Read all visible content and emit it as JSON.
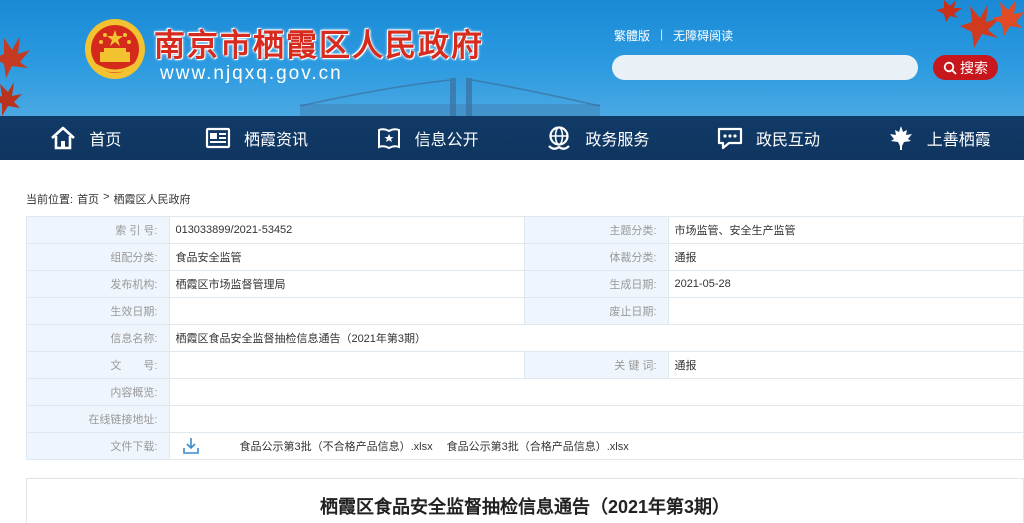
{
  "header": {
    "site_title": "南京市栖霞区人民政府",
    "site_url": "www.njqxq.gov.cn",
    "links": [
      "繁體版",
      "无障碍阅读"
    ],
    "search": {
      "placeholder": "",
      "button_label": "搜索"
    },
    "colors": {
      "header_blue": "#2b9ae0",
      "title_red": "#d62b1e",
      "nav_navy": "#113a66",
      "search_red": "#c8161d"
    }
  },
  "nav": {
    "items": [
      {
        "label": "首页",
        "icon": "home-icon"
      },
      {
        "label": "栖霞资讯",
        "icon": "news-icon"
      },
      {
        "label": "信息公开",
        "icon": "info-book-icon"
      },
      {
        "label": "政务服务",
        "icon": "service-globe-icon"
      },
      {
        "label": "政民互动",
        "icon": "chat-icon"
      },
      {
        "label": "上善栖霞",
        "icon": "maple-leaf-icon"
      }
    ]
  },
  "breadcrumb": {
    "prefix": "当前位置:",
    "items": [
      "首页",
      "栖霞区人民政府"
    ],
    "separator": ">"
  },
  "meta": {
    "index_label": "索 引 号:",
    "index_value": "013033899/2021-53452",
    "topic_label": "主题分类:",
    "topic_value": "市场监管、安全生产监管",
    "group_label": "组配分类:",
    "group_value": "食品安全监管",
    "genre_label": "体裁分类:",
    "genre_value": "通报",
    "publisher_label": "发布机构:",
    "publisher_value": "栖霞区市场监督管理局",
    "created_label": "生成日期:",
    "created_value": "2021-05-28",
    "effective_label": "生效日期:",
    "effective_value": "",
    "expire_label": "废止日期:",
    "expire_value": "",
    "name_label": "信息名称:",
    "name_value": "栖霞区食品安全监督抽检信息通告（2021年第3期）",
    "doc_label": "文　　号:",
    "doc_value": "",
    "keyword_label": "关 键 词:",
    "keyword_value": "通报",
    "summary_label": "内容概览:",
    "summary_value": "",
    "link_label": "在线链接地址:",
    "link_value": "",
    "download_label": "文件下载:",
    "downloads": [
      "食品公示第3批（不合格产品信息）.xlsx",
      "食品公示第3批（合格产品信息）.xlsx"
    ]
  },
  "article": {
    "title": "栖霞区食品安全监督抽检信息通告（2021年第3期）"
  }
}
